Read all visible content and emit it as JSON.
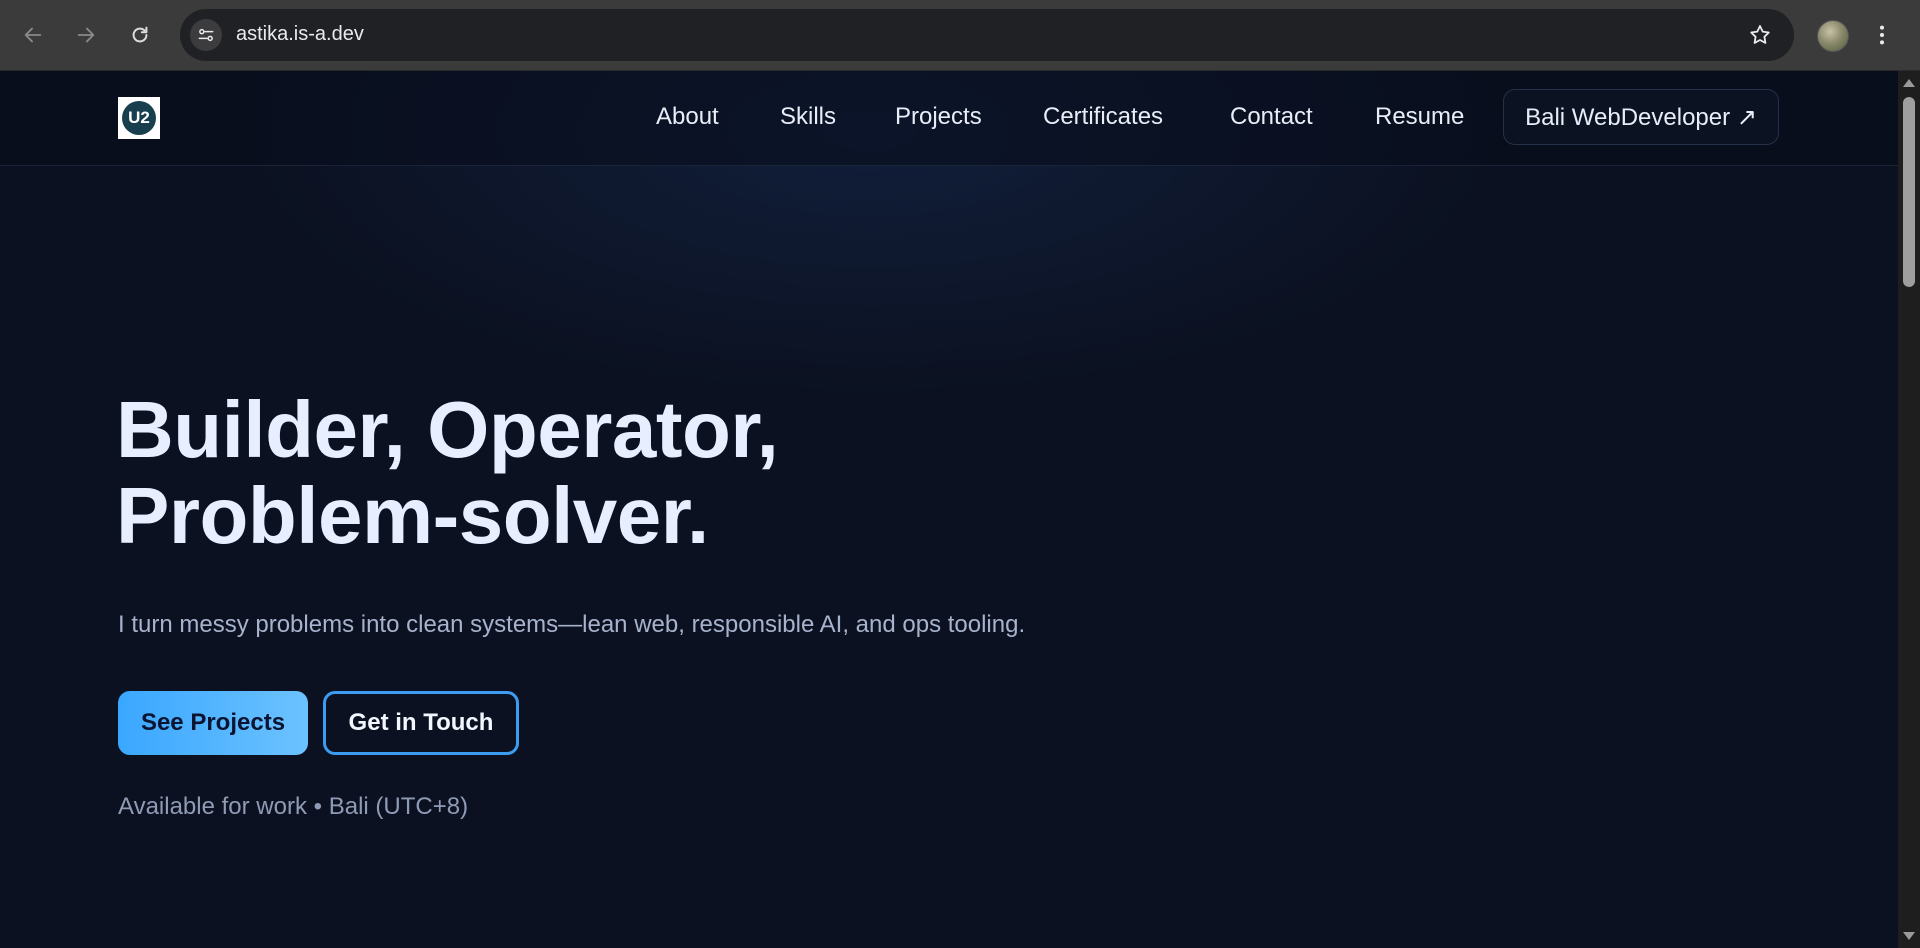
{
  "browser": {
    "url": "astika.is-a.dev",
    "back_icon": "arrow-left-icon",
    "forward_icon": "arrow-right-icon",
    "reload_icon": "reload-icon",
    "site_info_icon": "tune-icon",
    "bookmark_icon": "star-outline-icon",
    "menu_icon": "kebab-menu-icon"
  },
  "header": {
    "logo_text": "U2",
    "nav": [
      {
        "label": "About"
      },
      {
        "label": "Skills"
      },
      {
        "label": "Projects"
      },
      {
        "label": "Certificates"
      },
      {
        "label": "Contact"
      },
      {
        "label": "Resume"
      }
    ],
    "cta_label": "Bali WebDeveloper ↗"
  },
  "hero": {
    "title_line1": "Builder, Operator,",
    "title_line2": "Problem-solver.",
    "subtitle": "I turn messy problems into clean systems—lean web, responsible AI, and ops tooling.",
    "primary_button": "See Projects",
    "secondary_button": "Get in Touch",
    "availability": "Available for work • Bali (UTC+8)"
  },
  "colors": {
    "background": "#0b1120",
    "accent": "#3aa7ff",
    "accent_border": "#3b9cf2",
    "text_primary": "#e7eeff",
    "text_muted": "#a7b3cc"
  }
}
